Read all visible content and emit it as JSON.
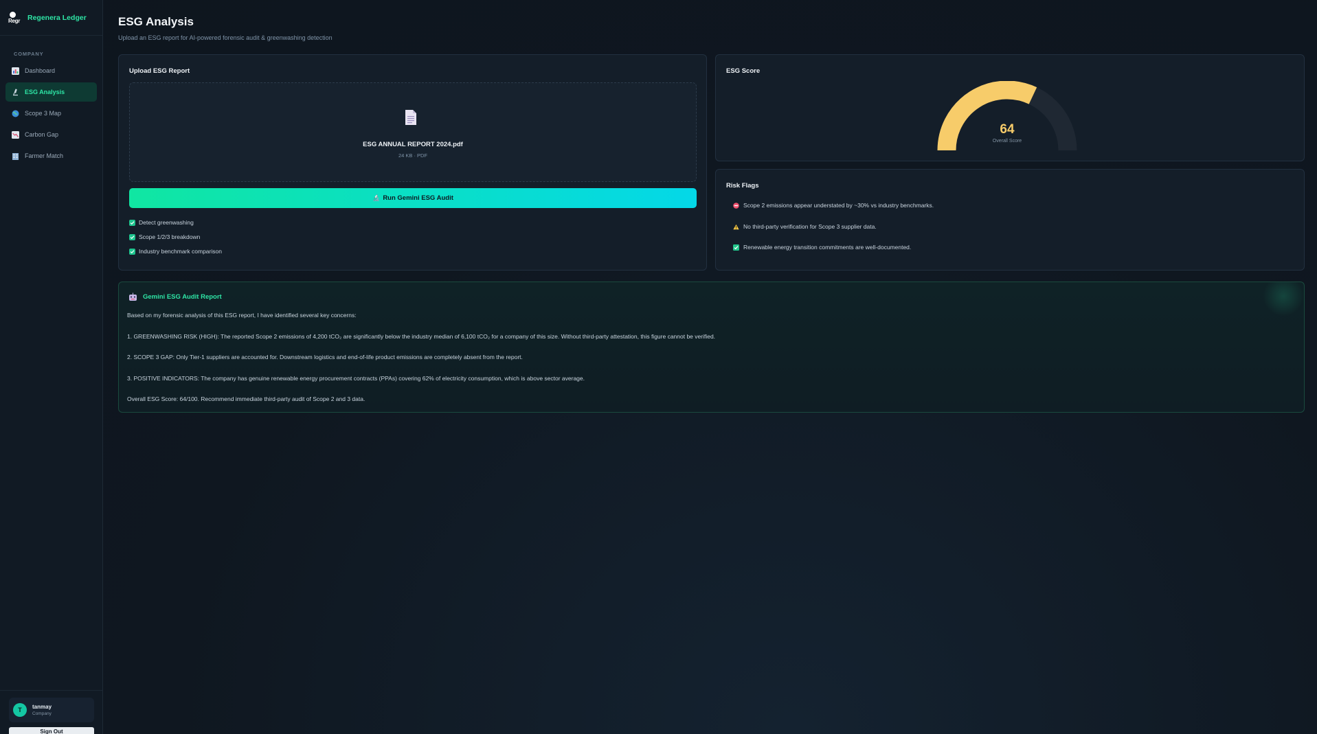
{
  "brand": {
    "logo_text": "Regr",
    "name": "Regenera Ledger"
  },
  "sidebar": {
    "section": "COMPANY",
    "items": [
      {
        "label": "Dashboard",
        "icon": "bar-chart-icon"
      },
      {
        "label": "ESG Analysis",
        "icon": "microscope-icon",
        "active": true
      },
      {
        "label": "Scope 3 Map",
        "icon": "globe-icon"
      },
      {
        "label": "Carbon Gap",
        "icon": "trend-down-icon"
      },
      {
        "label": "Farmer Match",
        "icon": "building-icon"
      }
    ]
  },
  "user": {
    "initial": "T",
    "name": "tanmay",
    "role": "Company",
    "signout_label": "Sign Out"
  },
  "page": {
    "title": "ESG Analysis",
    "subtitle": "Upload an ESG report for AI-powered forensic audit & greenwashing detection"
  },
  "upload": {
    "title": "Upload ESG Report",
    "file_name": "ESG ANNUAL REPORT 2024.pdf",
    "file_meta": "24 KB · PDF",
    "run_label": "Run Gemini ESG Audit",
    "options": [
      "Detect greenwashing",
      "Scope 1/2/3 breakdown",
      "Industry benchmark comparison"
    ]
  },
  "score": {
    "title": "ESG Score",
    "value": 64,
    "display": "64",
    "max": 100,
    "label": "Overall Score",
    "color": "#f7cc6a",
    "track_color": "#1f2833"
  },
  "risk": {
    "title": "Risk Flags",
    "flags": [
      {
        "icon": "no-entry-icon",
        "color": "#f0506e",
        "text": "Scope 2 emissions appear understated by ~30% vs industry benchmarks."
      },
      {
        "icon": "warning-icon",
        "color": "#f7c948",
        "text": "No third-party verification for Scope 3 supplier data."
      },
      {
        "icon": "check-icon",
        "color": "#22c58b",
        "text": "Renewable energy transition commitments are well-documented."
      }
    ]
  },
  "report": {
    "title": "Gemini ESG Audit Report",
    "lines": [
      "Based on my forensic analysis of this ESG report, I have identified several key concerns:",
      "1. GREENWASHING RISK (HIGH): The reported Scope 2 emissions of 4,200 tCO₂ are significantly below the industry median of 6,100 tCO₂ for a company of this size. Without third-party attestation, this figure cannot be verified.",
      "2. SCOPE 3 GAP: Only Tier-1 suppliers are accounted for. Downstream logistics and end-of-life product emissions are completely absent from the report.",
      "3. POSITIVE INDICATORS: The company has genuine renewable energy procurement contracts (PPAs) covering 62% of electricity consumption, which is above sector average.",
      "Overall ESG Score: 64/100. Recommend immediate third-party audit of Scope 2 and 3 data."
    ]
  }
}
